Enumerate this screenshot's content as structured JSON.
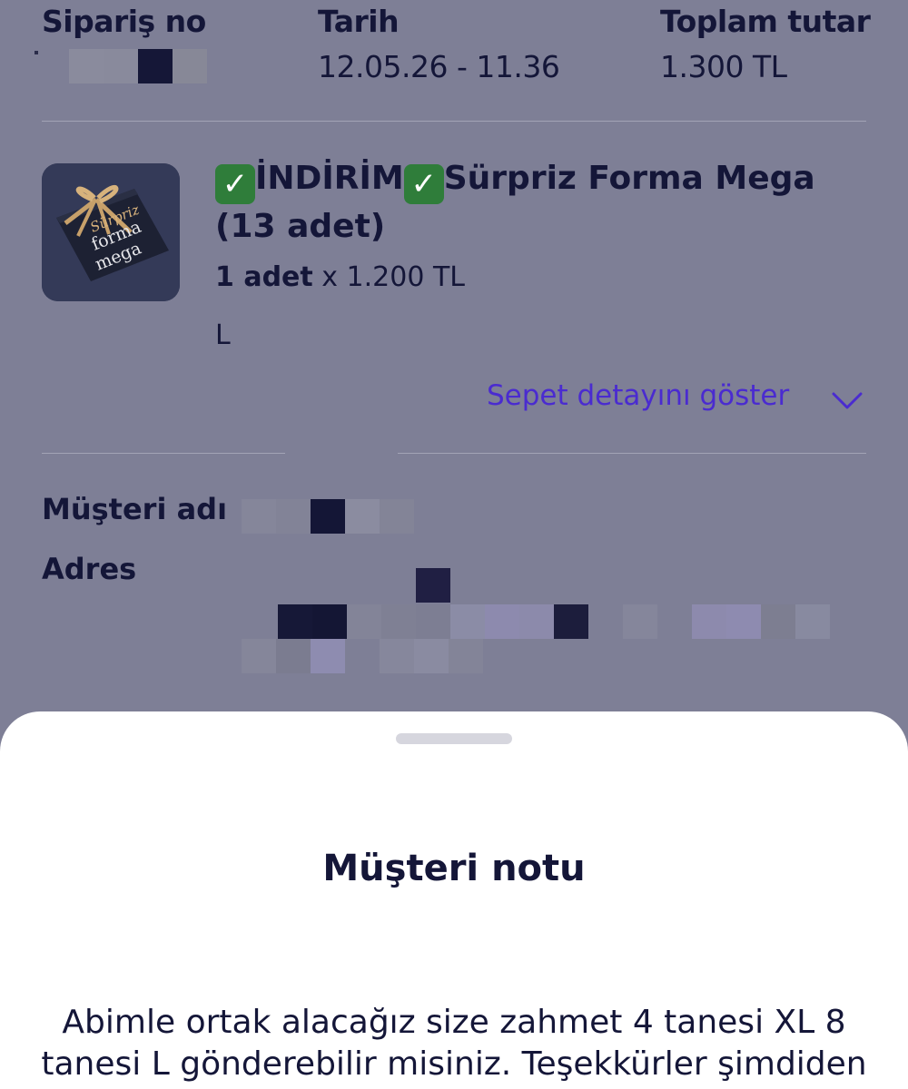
{
  "header": {
    "order_no_label": "Sipariş no",
    "date_label": "Tarih",
    "date_value": "12.05.26 - 11.36",
    "total_label": "Toplam tutar",
    "total_value": "1.300 TL"
  },
  "product": {
    "title_part1": "İNDİRİM",
    "title_part2": "Sürpriz Forma Mega",
    "title_part3": "(13 adet)",
    "check_glyph": "✓",
    "quantity_bold": "1 adet",
    "quantity_rest": " x 1.200 TL",
    "size": "L",
    "image_text_line1": "Sürpriz",
    "image_text_line2": "forma",
    "image_text_line3": "mega"
  },
  "basket_toggle": {
    "label": "Sepet detayını göster",
    "icon": "chevron-down-icon"
  },
  "customer": {
    "name_label": "Müşteri adı",
    "address_label": "Adres"
  },
  "sheet": {
    "title": "Müşteri notu",
    "note": "Abimle ortak alacağız size zahmet 4 tanesi XL 8 tanesi L gönderebilir misiniz. Teşekkürler şimdiden"
  },
  "colors": {
    "overlay_background": "#7e7f96",
    "text_dark": "#141638",
    "link_purple": "#4a2bd0",
    "check_green": "#2f7d3a",
    "sheet_background": "#ffffff"
  }
}
